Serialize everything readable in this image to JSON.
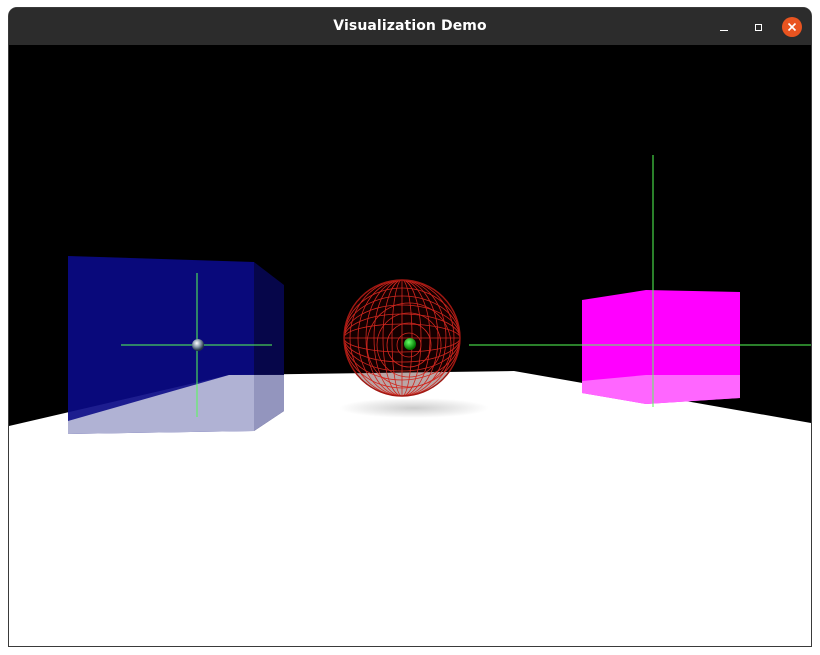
{
  "window": {
    "title": "Visualization Demo"
  },
  "icons": {
    "minimize": "minimize-icon",
    "maximize": "maximize-icon",
    "close": "close-icon"
  },
  "colors": {
    "titlebar": "#2c2c2c",
    "close_button": "#e95420",
    "background": "#000000",
    "floor": "#ffffff",
    "blue_cube": "#0a0a85",
    "magenta_cube": "#ff00ff",
    "wire_sphere": "#c0201a",
    "axes": "#55ff55",
    "marker": "#00aa00"
  }
}
